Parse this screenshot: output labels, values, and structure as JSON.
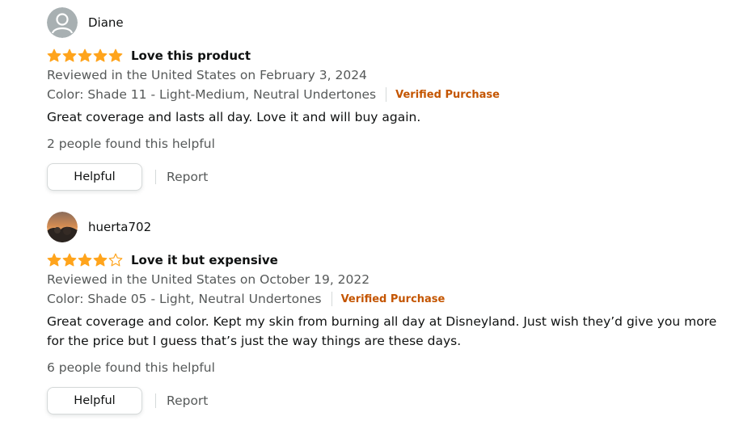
{
  "colors": {
    "star": "#ffa41c",
    "verified": "#c45500",
    "secondary_text": "#565959",
    "primary_text": "#0f1111"
  },
  "reviews": [
    {
      "reviewer": "Diane",
      "avatar": "default-person-icon",
      "rating": 5,
      "title": "Love this product",
      "date_line": "Reviewed in the United States on February 3, 2024",
      "variant": "Color: Shade 11 - Light-Medium, Neutral Undertones",
      "verified_label": "Verified Purchase",
      "body": "Great coverage and lasts all day. Love it and will buy again.",
      "helpful_count": "2 people found this helpful",
      "helpful_button": "Helpful",
      "report_label": "Report"
    },
    {
      "reviewer": "huerta702",
      "avatar": "profile-photo",
      "rating": 4,
      "title": "Love it but expensive",
      "date_line": "Reviewed in the United States on October 19, 2022",
      "variant": "Color: Shade 05 - Light, Neutral Undertones",
      "verified_label": "Verified Purchase",
      "body": "Great coverage and color. Kept my skin from burning all day at Disneyland. Just wish they’d give you more for the price but I guess that’s just the way things are these days.",
      "helpful_count": "6 people found this helpful",
      "helpful_button": "Helpful",
      "report_label": "Report"
    }
  ]
}
